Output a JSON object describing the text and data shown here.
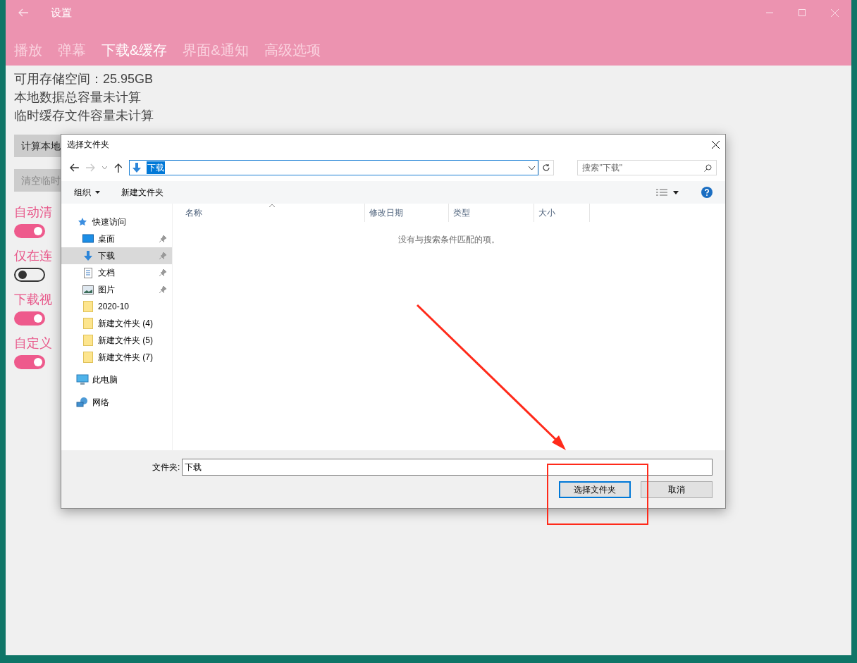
{
  "settings_window": {
    "title": "设置",
    "tabs": [
      {
        "label": "播放",
        "selected": false
      },
      {
        "label": "弹幕",
        "selected": false
      },
      {
        "label": "下载&缓存",
        "selected": true
      },
      {
        "label": "界面&通知",
        "selected": false
      },
      {
        "label": "高级选项",
        "selected": false
      }
    ],
    "storage_lines": [
      "可用存储空间：25.95GB",
      "本地数据总容量未计算",
      "临时缓存文件容量未计算"
    ],
    "buttons": [
      {
        "label": "计算本地",
        "disabled": false
      },
      {
        "label": "清空临时",
        "disabled": true
      }
    ],
    "options": [
      {
        "title": "自动清",
        "on": true
      },
      {
        "title": "仅在连",
        "on": false
      },
      {
        "title": "下载视",
        "on": true
      },
      {
        "title": "自定义",
        "on": true
      }
    ]
  },
  "dialog": {
    "title": "选择文件夹",
    "address": {
      "value": "下载"
    },
    "search": {
      "placeholder": "搜索\"下载\""
    },
    "toolbar": {
      "organize": "组织",
      "new_folder": "新建文件夹"
    },
    "nav": [
      {
        "label": "快速访问",
        "kind": "star",
        "selected": false,
        "children": [
          {
            "label": "桌面",
            "kind": "desktop",
            "selected": false,
            "pinned": true
          },
          {
            "label": "下载",
            "kind": "download",
            "selected": true,
            "pinned": true
          },
          {
            "label": "文档",
            "kind": "document",
            "selected": false,
            "pinned": true
          },
          {
            "label": "图片",
            "kind": "pictures",
            "selected": false,
            "pinned": true
          },
          {
            "label": "2020-10",
            "kind": "folder",
            "selected": false,
            "pinned": false
          },
          {
            "label": "新建文件夹 (4)",
            "kind": "folder",
            "selected": false,
            "pinned": false
          },
          {
            "label": "新建文件夹 (5)",
            "kind": "folder",
            "selected": false,
            "pinned": false
          },
          {
            "label": "新建文件夹 (7)",
            "kind": "folder",
            "selected": false,
            "pinned": false
          }
        ]
      },
      {
        "label": "此电脑",
        "kind": "computer",
        "selected": false
      },
      {
        "label": "网络",
        "kind": "network",
        "selected": false
      }
    ],
    "columns": [
      "名称",
      "修改日期",
      "类型",
      "大小"
    ],
    "empty_message": "没有与搜索条件匹配的项。",
    "folder_field": {
      "label": "文件夹:",
      "value": "下载"
    },
    "buttons": [
      {
        "label": "选择文件夹",
        "kind": "primary"
      },
      {
        "label": "取消",
        "kind": "default"
      }
    ]
  }
}
